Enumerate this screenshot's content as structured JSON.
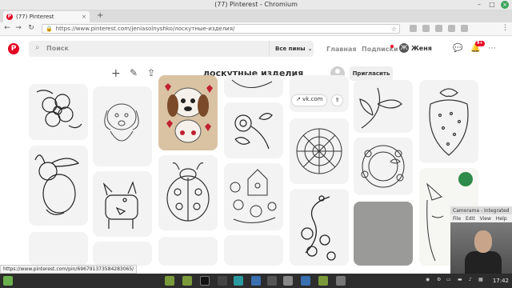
{
  "window": {
    "title": "(77) Pinterest - Chromium"
  },
  "tab": {
    "title": "(77) Pinterest",
    "close": "×",
    "new_tab": "+"
  },
  "address": {
    "url": "https://www.pinterest.com/jeniasolnyshko/лоскутные-изделия/"
  },
  "pinterest": {
    "logo": "P",
    "search_placeholder": "Поиск",
    "search_scope": "Все пины",
    "nav_home": "Главная",
    "nav_following": "Подписки",
    "user_initial": "Ж",
    "user_name": "Женя",
    "notif_badge": "9+"
  },
  "board": {
    "title": "лоскутные изделия",
    "invite_label": "Пригласить",
    "pin_source": "vk.com"
  },
  "status_url": "https://www.pinterest.com/pin/696791373584283065/",
  "camorama": {
    "title": "Camorama - Integrated",
    "menu": [
      "File",
      "Edit",
      "View",
      "Help"
    ]
  },
  "taskbar": {
    "clock": "17:42"
  },
  "colors": {
    "accent": "#e60023",
    "taskbar": "#2d2d2d"
  }
}
